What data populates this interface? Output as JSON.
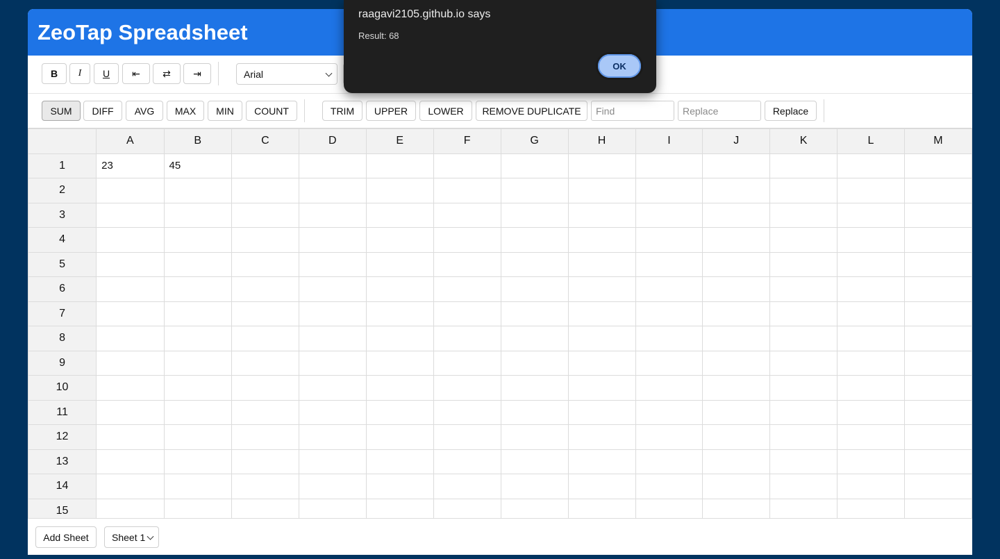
{
  "header": {
    "title": "ZeoTap Spreadsheet"
  },
  "format_toolbar": {
    "bold": "B",
    "italic": "I",
    "underline": "U",
    "align_left_glyph": "⇤",
    "align_center_glyph": "⇄",
    "align_right_glyph": "⇥",
    "font_family": "Arial"
  },
  "functions_toolbar": {
    "buttons": [
      "SUM",
      "DIFF",
      "AVG",
      "MAX",
      "MIN",
      "COUNT"
    ],
    "active": "SUM",
    "text_buttons": [
      "TRIM",
      "UPPER",
      "LOWER",
      "REMOVE DUPLICATE"
    ],
    "find_placeholder": "Find",
    "replace_placeholder": "Replace",
    "replace_button": "Replace"
  },
  "grid": {
    "columns": [
      "A",
      "B",
      "C",
      "D",
      "E",
      "F",
      "G",
      "H",
      "I",
      "J",
      "K",
      "L",
      "M"
    ],
    "rows": [
      "1",
      "2",
      "3",
      "4",
      "5",
      "6",
      "7",
      "8",
      "9",
      "10",
      "11",
      "12",
      "13",
      "14",
      "15"
    ],
    "cells": {
      "A1": "23",
      "B1": "45"
    }
  },
  "footer": {
    "add_sheet": "Add Sheet",
    "sheet_select": "Sheet 1"
  },
  "dialog": {
    "title": "raagavi2105.github.io says",
    "message": "Result: 68",
    "ok": "OK"
  },
  "colors": {
    "background": "#01335f",
    "header": "#1e74e6",
    "dialog": "#1f1f1f",
    "ok_button": "#a9c8f7"
  }
}
